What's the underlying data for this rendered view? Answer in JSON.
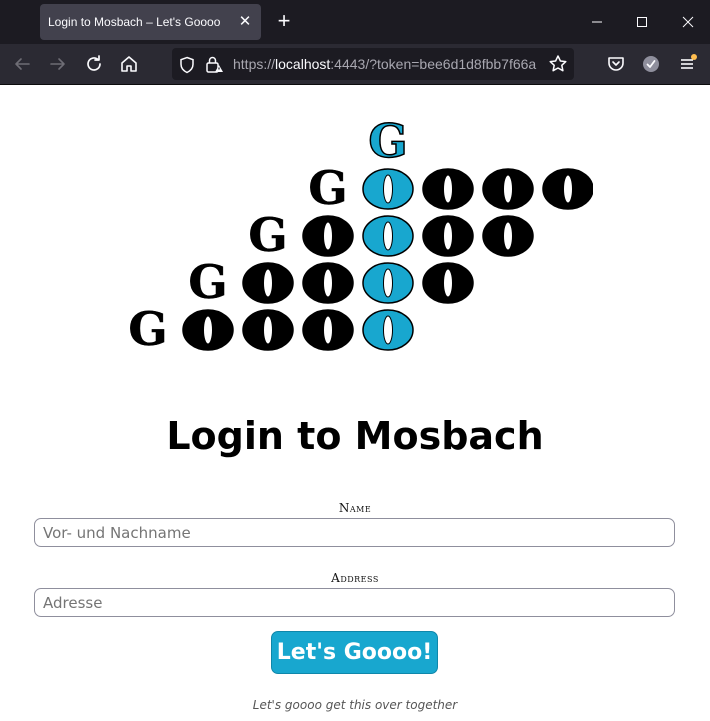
{
  "browser": {
    "tab_title": "Login to Mosbach – Let's Goooo",
    "tab_close": "✕",
    "new_tab": "+",
    "url_scheme": "https://",
    "url_host": "localhost",
    "url_rest": ":4443/?token=bee6d1d8fbb7f66a"
  },
  "logo": {
    "rows": [
      "G",
      "GOOOO",
      "GOOOO",
      "GOOOO",
      "GOOOO"
    ],
    "colors": {
      "ink": "#000000",
      "highlight": "#18a7cf"
    }
  },
  "page": {
    "heading": "Login to Mosbach",
    "name_label": "Name",
    "name_placeholder": "Vor- und Nachname",
    "address_label": "Address",
    "address_placeholder": "Adresse",
    "submit_label": "Let's Goooo!",
    "tagline": "Let's goooo get this over together"
  },
  "colors": {
    "tabbar": "#1c1b22",
    "navbar": "#2b2a33",
    "accent": "#18a7cf"
  }
}
